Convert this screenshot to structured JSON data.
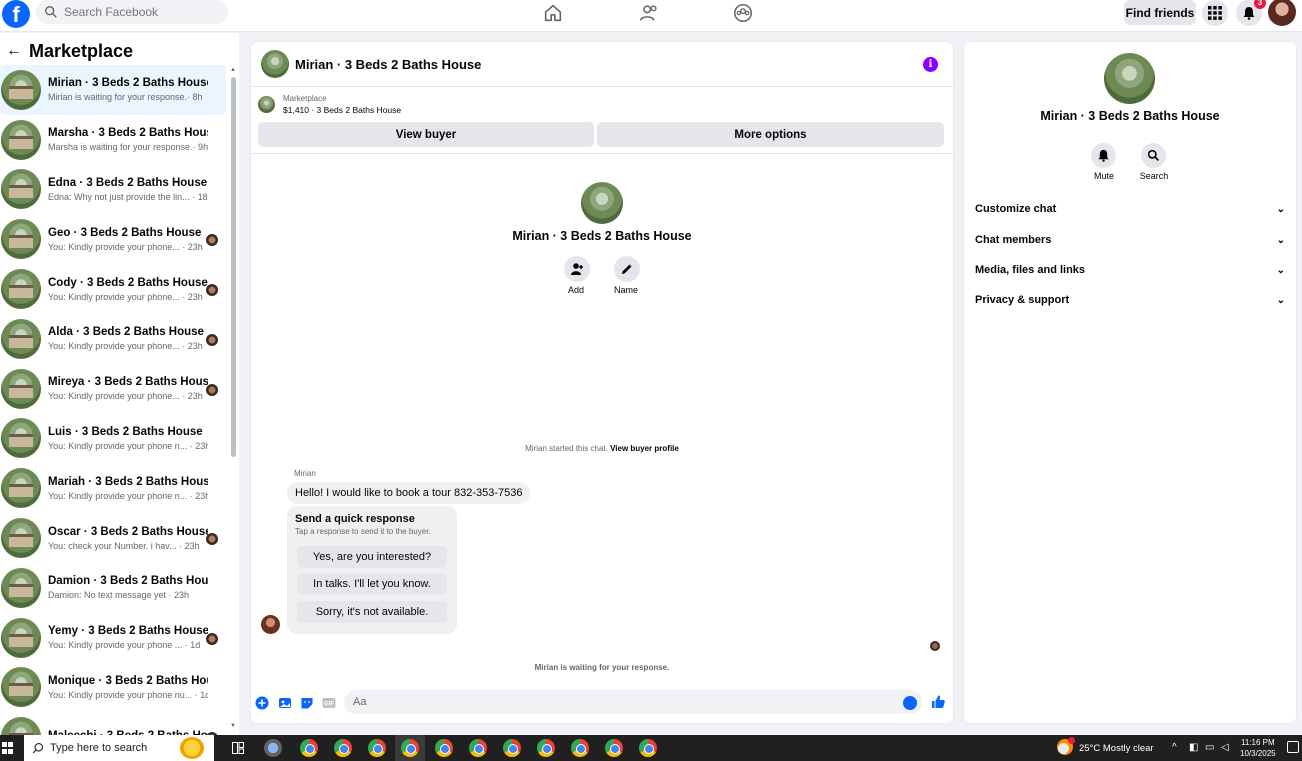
{
  "header": {
    "search_placeholder": "Search Facebook",
    "find_friends_label": "Find friends",
    "notification_count": "3",
    "nav_icons": [
      "home-icon",
      "friends-icon",
      "groups-icon"
    ],
    "accent_color": "#0866ff"
  },
  "sidebar": {
    "title": "Marketplace",
    "conversations": [
      {
        "name": "Mirian · 3 Beds 2 Baths House",
        "preview": "Mirian is waiting for your response.· 8h",
        "active": true,
        "has_seen_avatar": false
      },
      {
        "name": "Marsha · 3 Beds 2 Baths House",
        "preview": "Marsha is waiting for your response.· 9h",
        "active": false,
        "has_seen_avatar": false
      },
      {
        "name": "Edna · 3 Beds 2 Baths House",
        "preview": "Edna: Why not just provide the lin... · 18h",
        "active": false,
        "has_seen_avatar": false
      },
      {
        "name": "Geo · 3 Beds 2 Baths House",
        "preview": "You: Kindly provide your phone... · 23h",
        "active": false,
        "has_seen_avatar": true
      },
      {
        "name": "Cody · 3 Beds 2 Baths House",
        "preview": "You: Kindly provide your phone... · 23h",
        "active": false,
        "has_seen_avatar": true
      },
      {
        "name": "Alda · 3 Beds 2 Baths House",
        "preview": "You: Kindly provide your phone... · 23h",
        "active": false,
        "has_seen_avatar": true
      },
      {
        "name": "Mireya · 3 Beds 2 Baths House",
        "preview": "You: Kindly provide your phone... · 23h",
        "active": false,
        "has_seen_avatar": true
      },
      {
        "name": "Luis · 3 Beds 2 Baths House",
        "preview": "You: Kindly provide your phone n... · 23h",
        "active": false,
        "has_seen_avatar": false
      },
      {
        "name": "Mariah · 3 Beds 2 Baths House",
        "preview": "You: Kindly provide your phone n... · 23h",
        "active": false,
        "has_seen_avatar": false
      },
      {
        "name": "Oscar · 3 Beds 2 Baths House",
        "preview": "You: check your Number. i hav... · 23h",
        "active": false,
        "has_seen_avatar": true
      },
      {
        "name": "Damion · 3 Beds 2 Baths House",
        "preview": "Damion: No text message yet · 23h",
        "active": false,
        "has_seen_avatar": false
      },
      {
        "name": "Yemy · 3 Beds 2 Baths House",
        "preview": "You: Kindly provide your phone ... · 1d",
        "active": false,
        "has_seen_avatar": true
      },
      {
        "name": "Monique · 3 Beds 2 Baths House",
        "preview": "You: Kindly provide your phone nu... · 1d",
        "active": false,
        "has_seen_avatar": false
      },
      {
        "name": "Maleechi · 3 Beds 2 Baths Ho...",
        "preview": "",
        "active": false,
        "has_seen_avatar": true
      }
    ]
  },
  "chat": {
    "title": "Mirian · 3 Beds 2 Baths House",
    "marketplace_label": "Marketplace",
    "listing_price_title": "$1,410 · 3 Beds 2 Baths House",
    "view_buyer_label": "View buyer",
    "more_options_label": "More options",
    "center_name": "Mirian · 3 Beds 2 Baths House",
    "add_label": "Add",
    "name_label": "Name",
    "started_text": "Mirian started this chat.",
    "view_buyer_profile_label": "View buyer profile",
    "sender_name": "Mirian",
    "message": "Hello! I would like to book a tour 832-353-7536",
    "quick_response_title": "Send a quick response",
    "quick_response_subtitle": "Tap a response to send it to the buyer.",
    "quick_responses": [
      "Yes, are you interested?",
      "In talks. I'll let you know.",
      "Sorry, it's not available."
    ],
    "waiting_text": "Mirian is waiting for your response.",
    "composer_placeholder": "Aa"
  },
  "right_panel": {
    "name": "Mirian · 3 Beds 2 Baths House",
    "mute_label": "Mute",
    "search_label": "Search",
    "sections": [
      "Customize chat",
      "Chat members",
      "Media, files and links",
      "Privacy & support"
    ]
  },
  "taskbar": {
    "search_placeholder": "Type here to search",
    "weather": "25°C  Mostly clear",
    "time": "11:16 PM",
    "date": "10/3/2025"
  }
}
